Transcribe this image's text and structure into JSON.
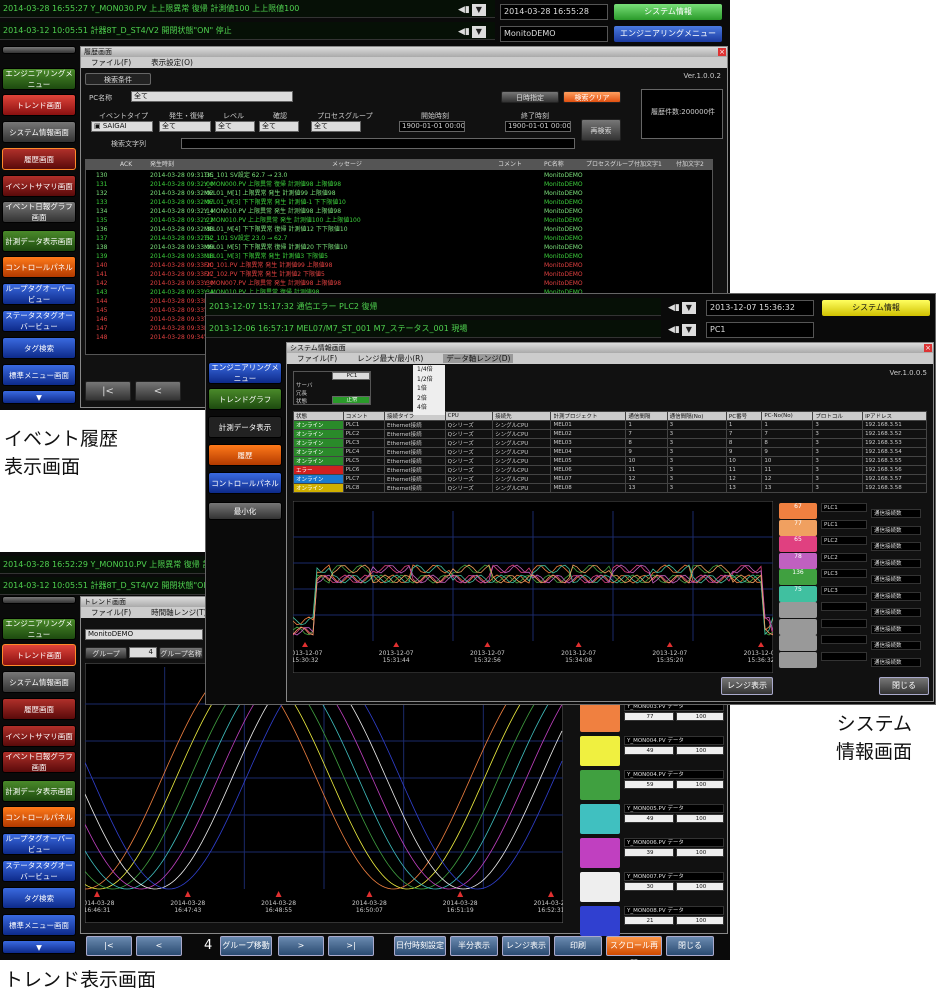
{
  "captions": {
    "event": "イベント履歴\n表示画面",
    "system": "システム\n情報画面",
    "trend": "トレンド表示画面"
  },
  "event_screen": {
    "alarm1": "2014-03-28 16:55:27 Y_MON030.PV 上上限異常 復帰 計測値100 上上限値100",
    "alarm2": "2014-03-12 10:05:51 計器8T_D_ST4/V2 開閉状態\"ON\" 停止",
    "datetime": "2014-03-28 16:55:28",
    "user": "MonitoDEMO",
    "btn_sysinfo": "システム情報",
    "btn_engmenu": "エンジニアリングメニュー",
    "nav": [
      "エンジニアリングメニュー",
      "トレンド画面",
      "システム情報画面",
      "履歴画面",
      "イベントサマリ画面",
      "イベント日報グラフ画面",
      "計測データ表示画面",
      "コントロールパネル",
      "ループタグオーバービュー",
      "ステータスタグオーバービュー",
      "タグ検索",
      "標準メニュー画面"
    ],
    "window_title": "履歴画面",
    "menu": [
      "ファイル(F)",
      "表示設定(O)"
    ],
    "tab": "検索条件",
    "version": "Ver.1.0.0.2",
    "pc_label": "PC名称",
    "pc_value": "全て",
    "event_type_label": "イベントタイプ",
    "occ_label": "発生・復帰",
    "level_label": "レベル",
    "ack_label": "確認",
    "proc_label": "プロセスグループ",
    "start_label": "開始時刻",
    "end_label": "終了時刻",
    "all": "全て",
    "start_time": "1900-01-01 00:00:00",
    "end_time": "1900-01-01 00:00:00",
    "btn_search": "再検索",
    "btn_a": "日時指定",
    "btn_b": "検索クリア",
    "count": "履歴件数:200000件",
    "keyword_label": "検索文字列",
    "cols": [
      "ACK",
      "発生時刻",
      "メッセージ",
      "コメント",
      "PC名称",
      "プロセスグループ",
      "付加文字1",
      "付加文字2"
    ],
    "rows": [
      {
        "n": "130",
        "t": "2014-03-28 09:31:35",
        "m": "TIC_101 SV設定 62.7 → 23.0",
        "pc": "MonitoDEMO"
      },
      {
        "n": "131",
        "t": "2014-03-28 09:32:00",
        "m": "Y_MON000.PV 上限異常 復帰 計測値98 上限値98",
        "pc": "MonitoDEMO"
      },
      {
        "n": "132",
        "t": "2014-03-28 09:32:02",
        "m": "MEL01_M[1] 上限異常 発生 計測値99 上限値98",
        "pc": "MonitoDEMO"
      },
      {
        "n": "133",
        "t": "2014-03-28 09:32:07",
        "m": "MEL01_M[3] 下下限異常 発生 計測値-1 下下限値10",
        "pc": "MonitoDEMO"
      },
      {
        "n": "134",
        "t": "2014-03-28 09:32:14",
        "m": "Y_MON010.PV 上限異常 発生 計測値98 上限値98",
        "pc": "MonitoDEMO"
      },
      {
        "n": "135",
        "t": "2014-03-28 09:32:22",
        "m": "Y_MON010.PV 上上限異常 発生 計測値100 上上限値100",
        "pc": "MonitoDEMO"
      },
      {
        "n": "136",
        "t": "2014-03-28 09:32:38",
        "m": "MEL01_M[4] 下下限異常 復帰 計測値12 下下限値10",
        "pc": "MonitoDEMO"
      },
      {
        "n": "137",
        "t": "2014-03-28 09:32:52",
        "m": "TIC_101 SV設定 23.0 → 62.7",
        "pc": "MonitoDEMO"
      },
      {
        "n": "138",
        "t": "2014-03-28 09:33:09",
        "m": "MEL01_M[5] 下下限異常 復帰 計測値20 下下限値10",
        "pc": "MonitoDEMO"
      },
      {
        "n": "139",
        "t": "2014-03-28 09:33:18",
        "m": "MEL01_M[3] 下限異常 発生 計測値3 下限値5",
        "pc": "MonitoDEMO"
      },
      {
        "n": "140",
        "t": "2014-03-28 09:33:20",
        "m": "FIC_101.PV 上限異常 発生 計測値99 上限値98",
        "pc": "MonitoDEMO"
      },
      {
        "n": "141",
        "t": "2014-03-28 09:33:27",
        "m": "FIC_102.PV 下限異常 発生 計測値2 下限値5",
        "pc": "MonitoDEMO"
      },
      {
        "n": "142",
        "t": "2014-03-28 09:33:30",
        "m": "Y_MON007.PV 上限異常 発生 計測値98 上限値98",
        "pc": "MonitoDEMO"
      },
      {
        "n": "143",
        "t": "2014-03-28 09:33:34",
        "m": "Y_MON010.PV 上上限異常 復帰 計測値98",
        "pc": "MonitoDEMO"
      },
      {
        "n": "144",
        "t": "2014-03-28 09:33:41",
        "m": "MEL01_M[2] 上限異常 発生 計測値99",
        "pc": "MonitoDEMO"
      },
      {
        "n": "145",
        "t": "2014-03-28 09:33:46",
        "m": "Y_MON003.PV 上限異常 発生",
        "pc": "MonitoDEMO"
      },
      {
        "n": "146",
        "t": "2014-03-28 09:33:51",
        "m": "TIC_101 SV設定",
        "pc": "MonitoDEMO"
      },
      {
        "n": "147",
        "t": "2014-03-28 09:33:55",
        "m": "MEL01_M[1] 上限異常 復帰",
        "pc": "MonitoDEMO"
      },
      {
        "n": "148",
        "t": "2014-03-28 09:34:03",
        "m": "Y_MON000.PV 上限異常 発生",
        "pc": "MonitoDEMO"
      }
    ]
  },
  "system_screen": {
    "alarm1": "2013-12-07 15:17:32 通信エラー PLC2 復帰",
    "alarm2": "2013-12-06 16:57:17 MEL07/M7_ST_001 M7_ステータス_001 現場",
    "datetime": "2013-12-07 15:36:32",
    "pc": "PC1",
    "btn_sysinfo": "システム情報",
    "nav": [
      "エンジニアリングメニュー",
      "トレンドグラフ",
      "計測データ表示",
      "履歴",
      "コントロールパネル",
      "最小化"
    ],
    "window_title": "システム情報画面",
    "menu": [
      "ファイル(F)",
      "レンジ最大/最小(R)",
      "データ軸レンジ(D)"
    ],
    "dropdown": [
      "1/4倍",
      "1/2倍",
      "1倍",
      "2倍",
      "4倍"
    ],
    "version": "Ver.1.0.0.5",
    "st_pc": "PC1",
    "st_server": "サーバ",
    "st_redund": "冗長",
    "st_status": "状態",
    "st_normal": "正常",
    "plc_cols": [
      "状態",
      "コメント",
      "接続タイプ",
      "CPU",
      "接続先",
      "計測プロジェクト",
      "通信間隔",
      "通信間隔(No)",
      "PC番号",
      "PC-No(No)",
      "プロトコル",
      "IPアドレス"
    ],
    "plc_rows": [
      {
        "s": "オンライン",
        "c": "PLC1",
        "t": "Ethernet接続",
        "cpu": "Qシリーズ",
        "d": "シングルCPU",
        "p": "MEL01",
        "a": "1",
        "b": "3",
        "ip": "192.168.3.51",
        "sc": "#2a8a2a"
      },
      {
        "s": "オンライン",
        "c": "PLC2",
        "t": "Ethernet接続",
        "cpu": "Qシリーズ",
        "d": "シングルCPU",
        "p": "MEL02",
        "a": "7",
        "b": "3",
        "ip": "192.168.3.52",
        "sc": "#2a8a2a"
      },
      {
        "s": "オンライン",
        "c": "PLC3",
        "t": "Ethernet接続",
        "cpu": "Qシリーズ",
        "d": "シングルCPU",
        "p": "MEL03",
        "a": "8",
        "b": "3",
        "ip": "192.168.3.53",
        "sc": "#2a8a2a"
      },
      {
        "s": "オンライン",
        "c": "PLC4",
        "t": "Ethernet接続",
        "cpu": "Qシリーズ",
        "d": "シングルCPU",
        "p": "MEL04",
        "a": "9",
        "b": "3",
        "ip": "192.168.3.54",
        "sc": "#2a8a2a"
      },
      {
        "s": "オンライン",
        "c": "PLC5",
        "t": "Ethernet接続",
        "cpu": "Qシリーズ",
        "d": "シングルCPU",
        "p": "MEL05",
        "a": "10",
        "b": "3",
        "ip": "192.168.3.55",
        "sc": "#2a8a2a"
      },
      {
        "s": "エラー",
        "c": "PLC6",
        "t": "Ethernet接続",
        "cpu": "Qシリーズ",
        "d": "シングルCPU",
        "p": "MEL06",
        "a": "11",
        "b": "3",
        "ip": "192.168.3.56",
        "sc": "#d02020"
      },
      {
        "s": "オンライン",
        "c": "PLC7",
        "t": "Ethernet接続",
        "cpu": "Qシリーズ",
        "d": "シングルCPU",
        "p": "MEL07",
        "a": "12",
        "b": "3",
        "ip": "192.168.3.57",
        "sc": "#1a7ad0"
      },
      {
        "s": "オンライン",
        "c": "PLC8",
        "t": "Ethernet接続",
        "cpu": "Qシリーズ",
        "d": "シングルCPU",
        "p": "MEL08",
        "a": "13",
        "b": "3",
        "ip": "192.168.3.58",
        "sc": "#d0b000"
      }
    ],
    "x_ticks": [
      "2013-12-07\n15:30:32",
      "2013-12-07\n15:31:44",
      "2013-12-07\n15:32:56",
      "2013-12-07\n15:34:08",
      "2013-12-07\n15:35:20",
      "2013-12-07\n15:36:32"
    ],
    "legend": [
      {
        "v": "67",
        "plc": "PLC1",
        "mode": "通信接続数",
        "c": "#f08040"
      },
      {
        "v": "77",
        "plc": "PLC1",
        "mode": "通信接続数",
        "c": "#f0a060"
      },
      {
        "v": "65",
        "plc": "PLC2",
        "mode": "通信接続数",
        "c": "#e04080"
      },
      {
        "v": "78",
        "plc": "PLC2",
        "mode": "通信接続数",
        "c": "#c060c0"
      },
      {
        "v": "136",
        "plc": "PLC3",
        "mode": "通信接続数",
        "c": "#40a040"
      },
      {
        "v": "75",
        "plc": "PLC3",
        "mode": "通信接続数",
        "c": "#40c0a0"
      },
      {
        "v": "",
        "plc": "",
        "mode": "通信接続数",
        "c": "#999"
      },
      {
        "v": "",
        "plc": "",
        "mode": "通信接続数",
        "c": "#999"
      },
      {
        "v": "",
        "plc": "",
        "mode": "通信接続数",
        "c": "#999"
      },
      {
        "v": "",
        "plc": "",
        "mode": "通信接続数",
        "c": "#999"
      }
    ],
    "btn_range": "レンジ表示",
    "btn_close": "閉じる"
  },
  "trend_screen": {
    "alarm1": "2014-03-28 16:52:29 Y_MON010.PV 上限異常 復帰 計測値98 上限値98",
    "alarm2": "2014-03-12 10:05:51 計器8T_D_ST4/V2 開閉状態\"ON\" 停止",
    "nav": [
      "エンジニアリングメニュー",
      "トレンド画面",
      "システム情報画面",
      "履歴画面",
      "イベントサマリ画面",
      "イベント日報グラフ画面",
      "計測データ表示画面",
      "コントロールパネル",
      "ループタグオーバービュー",
      "ステータスタグオーバービュー",
      "タグ検索",
      "標準メニュー画面"
    ],
    "window_title": "トレンド画面",
    "menu": [
      "ファイル(F)",
      "時間軸レンジ(T)"
    ],
    "pc": "MonitoDEMO",
    "group_label": "グループ",
    "group_value": "4",
    "group_btn": "グループ名称",
    "x_ticks": [
      "2014-03-28\n16:46:31",
      "2014-03-28\n16:47:43",
      "2014-03-28\n16:48:55",
      "2014-03-28\n16:50:07",
      "2014-03-28\n16:51:19",
      "2014-03-28\n16:52:31"
    ],
    "legend": [
      {
        "tag": "Y_MON003.PV データ",
        "v": "77",
        "r": "100",
        "c": "#f08040"
      },
      {
        "tag": "Y_MON004.PV データ",
        "v": "49",
        "r": "100",
        "c": "#f0f040"
      },
      {
        "tag": "Y_MON004.PV データ",
        "v": "59",
        "r": "100",
        "c": "#40a040"
      },
      {
        "tag": "Y_MON005.PV データ",
        "v": "49",
        "r": "100",
        "c": "#40c0c0"
      },
      {
        "tag": "Y_MON006.PV データ",
        "v": "39",
        "r": "100",
        "c": "#c040c0"
      },
      {
        "tag": "Y_MON007.PV データ",
        "v": "30",
        "r": "100",
        "c": "#eeeeee"
      },
      {
        "tag": "Y_MON008.PV データ",
        "v": "21",
        "r": "100",
        "c": "#3040d0"
      }
    ],
    "page": "4",
    "btn_group_move": "グループ移動",
    "btn_time": "日付時刻設定",
    "btn_half": "半分表示",
    "btn_range": "レンジ表示",
    "btn_print": "印刷",
    "btn_scroll": "スクロール再開",
    "btn_close": "閉じる",
    "nav_first": "|<",
    "nav_prev": "<",
    "nav_next": ">",
    "nav_last": ">|"
  }
}
